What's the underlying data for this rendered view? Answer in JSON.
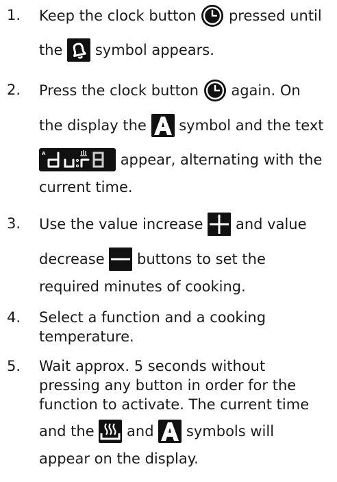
{
  "steps": [
    {
      "number": "1.",
      "line1_a": "Keep the clock button",
      "line1_b": "pressed until",
      "line2_a": "the",
      "line2_b": "symbol appears.",
      "icons": [
        "clock-icon",
        "bell-icon"
      ]
    },
    {
      "number": "2.",
      "line1_a": "Press the clock button",
      "line1_b": "again. On",
      "line2_a": "the display the",
      "line2_b": "symbol and the text",
      "line3_b": "appear, alternating with the",
      "line4": "current time.",
      "icons": [
        "clock-icon",
        "auto-a-icon",
        "duration-display-icon"
      ]
    },
    {
      "number": "3.",
      "line1_a": "Use the value increase",
      "line1_b": "and value",
      "line2_a": "decrease",
      "line2_b": "buttons to set the",
      "line3": "required minutes of cooking.",
      "icons": [
        "plus-icon",
        "minus-icon"
      ]
    },
    {
      "number": "4.",
      "line1": "Select a function and a cooking",
      "line2": "temperature."
    },
    {
      "number": "5.",
      "line1": "Wait approx. 5 seconds without",
      "line2": "pressing any button in order for the",
      "line3": "function to activate. The current time",
      "line4_a": "and the",
      "line4_b": "and",
      "line4_c": "symbols will",
      "line5": "appear on the display.",
      "icons": [
        "heating-icon",
        "auto-a-icon"
      ]
    }
  ],
  "colors": {
    "text": "#1a1a1a",
    "icon_bg": "#111111",
    "icon_fg": "#ffffff"
  }
}
